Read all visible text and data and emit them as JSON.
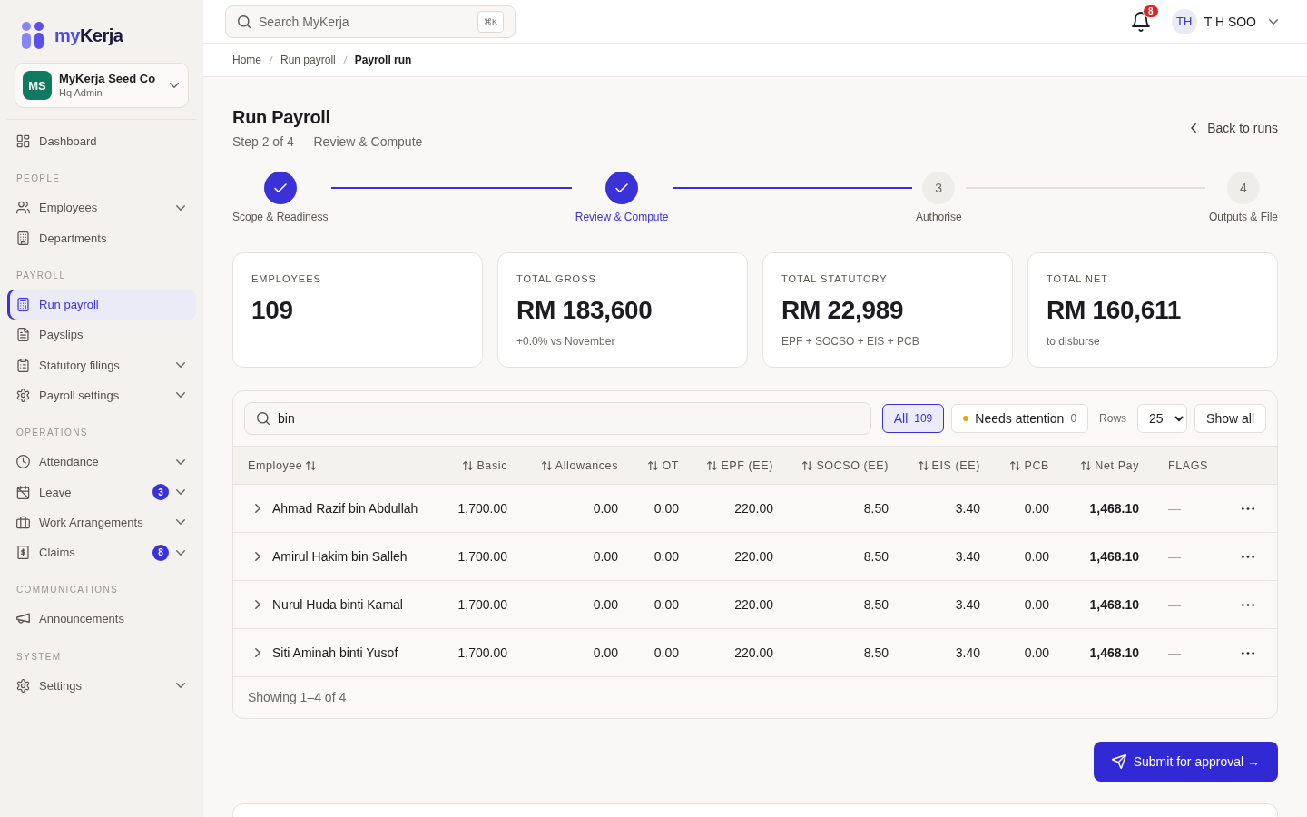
{
  "sidebar": {
    "brand": {
      "prefix": "my",
      "name": "Kerja"
    },
    "org": {
      "initials": "MS",
      "name": "MyKerja Seed Co",
      "role": "Hq Admin"
    },
    "sections": [
      {
        "items": [
          {
            "label": "Dashboard",
            "selected": false,
            "expandable": false
          }
        ]
      },
      {
        "title": "PEOPLE",
        "items": [
          {
            "label": "Employees",
            "selected": false,
            "expandable": true
          },
          {
            "label": "Departments",
            "selected": false,
            "expandable": false
          }
        ]
      },
      {
        "title": "PAYROLL",
        "items": [
          {
            "label": "Run payroll",
            "selected": true,
            "expandable": false
          },
          {
            "label": "Payslips",
            "selected": false,
            "expandable": false
          },
          {
            "label": "Statutory filings",
            "selected": false,
            "expandable": true
          },
          {
            "label": "Payroll settings",
            "selected": false,
            "expandable": true
          }
        ]
      },
      {
        "title": "OPERATIONS",
        "items": [
          {
            "label": "Attendance",
            "selected": false,
            "expandable": true
          },
          {
            "label": "Leave",
            "selected": false,
            "expandable": true,
            "badge": "3"
          },
          {
            "label": "Work Arrangements",
            "selected": false,
            "expandable": true
          },
          {
            "label": "Claims",
            "selected": false,
            "expandable": true,
            "badge": "8"
          }
        ]
      },
      {
        "title": "COMMUNICATIONS",
        "items": [
          {
            "label": "Announcements",
            "selected": false,
            "expandable": false
          }
        ]
      },
      {
        "title": "SYSTEM",
        "items": [
          {
            "label": "Settings",
            "selected": false,
            "expandable": true
          }
        ]
      }
    ]
  },
  "header": {
    "search": {
      "placeholder": "Search MyKerja",
      "shortcut": "⌘K"
    },
    "notifications": {
      "count": "8"
    },
    "user": {
      "initials": "TH",
      "name": "T H SOO"
    }
  },
  "breadcrumb": [
    {
      "label": "Home",
      "current": false
    },
    {
      "label": "Run payroll",
      "current": false
    },
    {
      "label": "Payroll run",
      "current": true
    }
  ],
  "page": {
    "title": "Run Payroll",
    "subtitle": "Step 2 of 4 — Review & Compute",
    "back_link": "Back to runs"
  },
  "steps": [
    {
      "label": "Scope & Readiness",
      "done": true,
      "selected": false
    },
    {
      "label": "Review & Compute",
      "done": true,
      "selected": true
    },
    {
      "label": "Authorise",
      "done": false,
      "number": "3",
      "selected": false
    },
    {
      "label": "Outputs & File",
      "done": false,
      "number": "4",
      "selected": false
    }
  ],
  "summary_cards": [
    {
      "label": "EMPLOYEES",
      "value": "109"
    },
    {
      "label": "TOTAL GROSS",
      "value": "RM 183,600",
      "note": "+0.0% vs November"
    },
    {
      "label": "TOTAL STATUTORY",
      "value": "RM 22,989",
      "note": "EPF + SOCSO + EIS + PCB"
    },
    {
      "label": "TOTAL NET",
      "value": "RM 160,611",
      "note": "to disburse"
    }
  ],
  "table": {
    "search": {
      "value": "bin"
    },
    "filters": [
      {
        "label": "All",
        "count": "109",
        "selected": true
      },
      {
        "label": "Needs attention",
        "count": "0",
        "selected": false,
        "color": "#f59e0b"
      }
    ],
    "rows_label": "Rows",
    "rows_per_page": "25",
    "show_all": "Show all",
    "columns": [
      {
        "label": "Employee",
        "sortable": true
      },
      {
        "label": "Basic",
        "sortable": true
      },
      {
        "label": "Allowances",
        "sortable": true
      },
      {
        "label": "OT",
        "sortable": true
      },
      {
        "label": "EPF (EE)",
        "sortable": true
      },
      {
        "label": "SOCSO (EE)",
        "sortable": true
      },
      {
        "label": "EIS (EE)",
        "sortable": true
      },
      {
        "label": "PCB",
        "sortable": true
      },
      {
        "label": "Net Pay",
        "sortable": true
      },
      {
        "label": "FLAGS",
        "sortable": false
      }
    ],
    "rows": [
      {
        "employee": "Ahmad Razif bin Abdullah",
        "expanded": false,
        "values": [
          "1,700.00",
          "0.00",
          "0.00",
          "220.00",
          "8.50",
          "3.40",
          "0.00",
          "1,468.10"
        ],
        "flags": "—"
      },
      {
        "employee": "Amirul Hakim bin Salleh",
        "expanded": false,
        "values": [
          "1,700.00",
          "0.00",
          "0.00",
          "220.00",
          "8.50",
          "3.40",
          "0.00",
          "1,468.10"
        ],
        "flags": "—"
      },
      {
        "employee": "Nurul Huda binti Kamal",
        "expanded": false,
        "values": [
          "1,700.00",
          "0.00",
          "0.00",
          "220.00",
          "8.50",
          "3.40",
          "0.00",
          "1,468.10"
        ],
        "flags": "—"
      },
      {
        "employee": "Siti Aminah binti Yusof",
        "expanded": false,
        "values": [
          "1,700.00",
          "0.00",
          "0.00",
          "220.00",
          "8.50",
          "3.40",
          "0.00",
          "1,468.10"
        ],
        "flags": "—"
      }
    ],
    "footer": "Showing 1–4 of 4"
  },
  "submit_button": "Submit for approval →"
}
